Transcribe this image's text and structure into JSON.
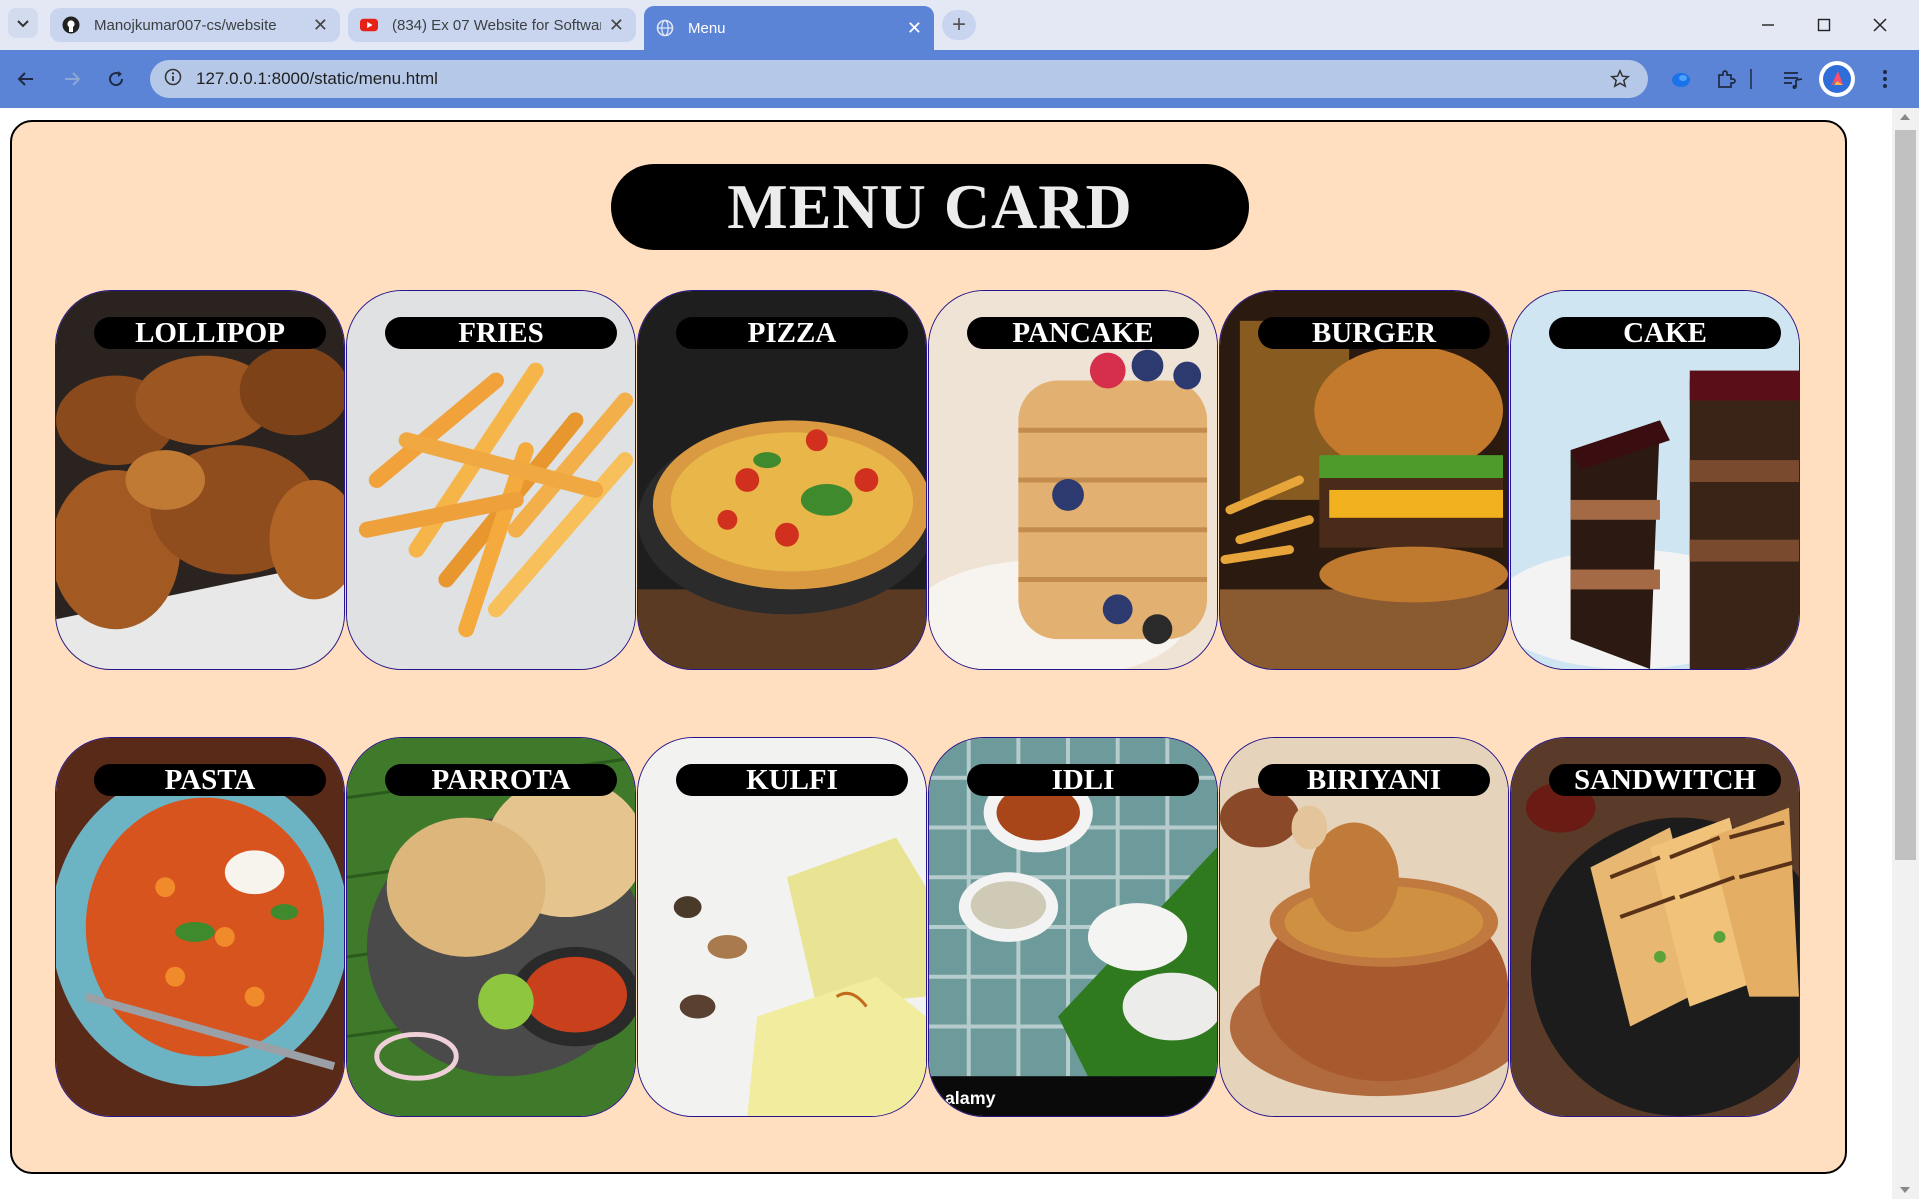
{
  "browser": {
    "tabs": [
      {
        "title": "Manojkumar007-cs/website",
        "icon": "github-icon"
      },
      {
        "title": "(834) Ex 07 Website for Softwar",
        "icon": "youtube-icon"
      },
      {
        "title": "Menu",
        "icon": "globe-icon",
        "active": true
      }
    ],
    "new_tab": "+",
    "url": "127.0.0.1:8000/static/menu.html",
    "window_controls": [
      "minimize-icon",
      "maximize-icon",
      "close-icon"
    ]
  },
  "page": {
    "title": "MENU CARD",
    "items": [
      {
        "label": "LOLLIPOP"
      },
      {
        "label": "FRIES"
      },
      {
        "label": "PIZZA"
      },
      {
        "label": "PANCAKE"
      },
      {
        "label": "BURGER"
      },
      {
        "label": "CAKE"
      },
      {
        "label": "PASTA"
      },
      {
        "label": "PARROTA"
      },
      {
        "label": "KULFI"
      },
      {
        "label": "IDLI"
      },
      {
        "label": "BIRIYANI"
      },
      {
        "label": "SANDWITCH"
      }
    ],
    "watermark": "alamy"
  },
  "colors": {
    "panel_bg": "#ffdfc0",
    "title_bg": "#000000",
    "card_border": "#26158a",
    "chrome_accent": "#5b84d6"
  }
}
